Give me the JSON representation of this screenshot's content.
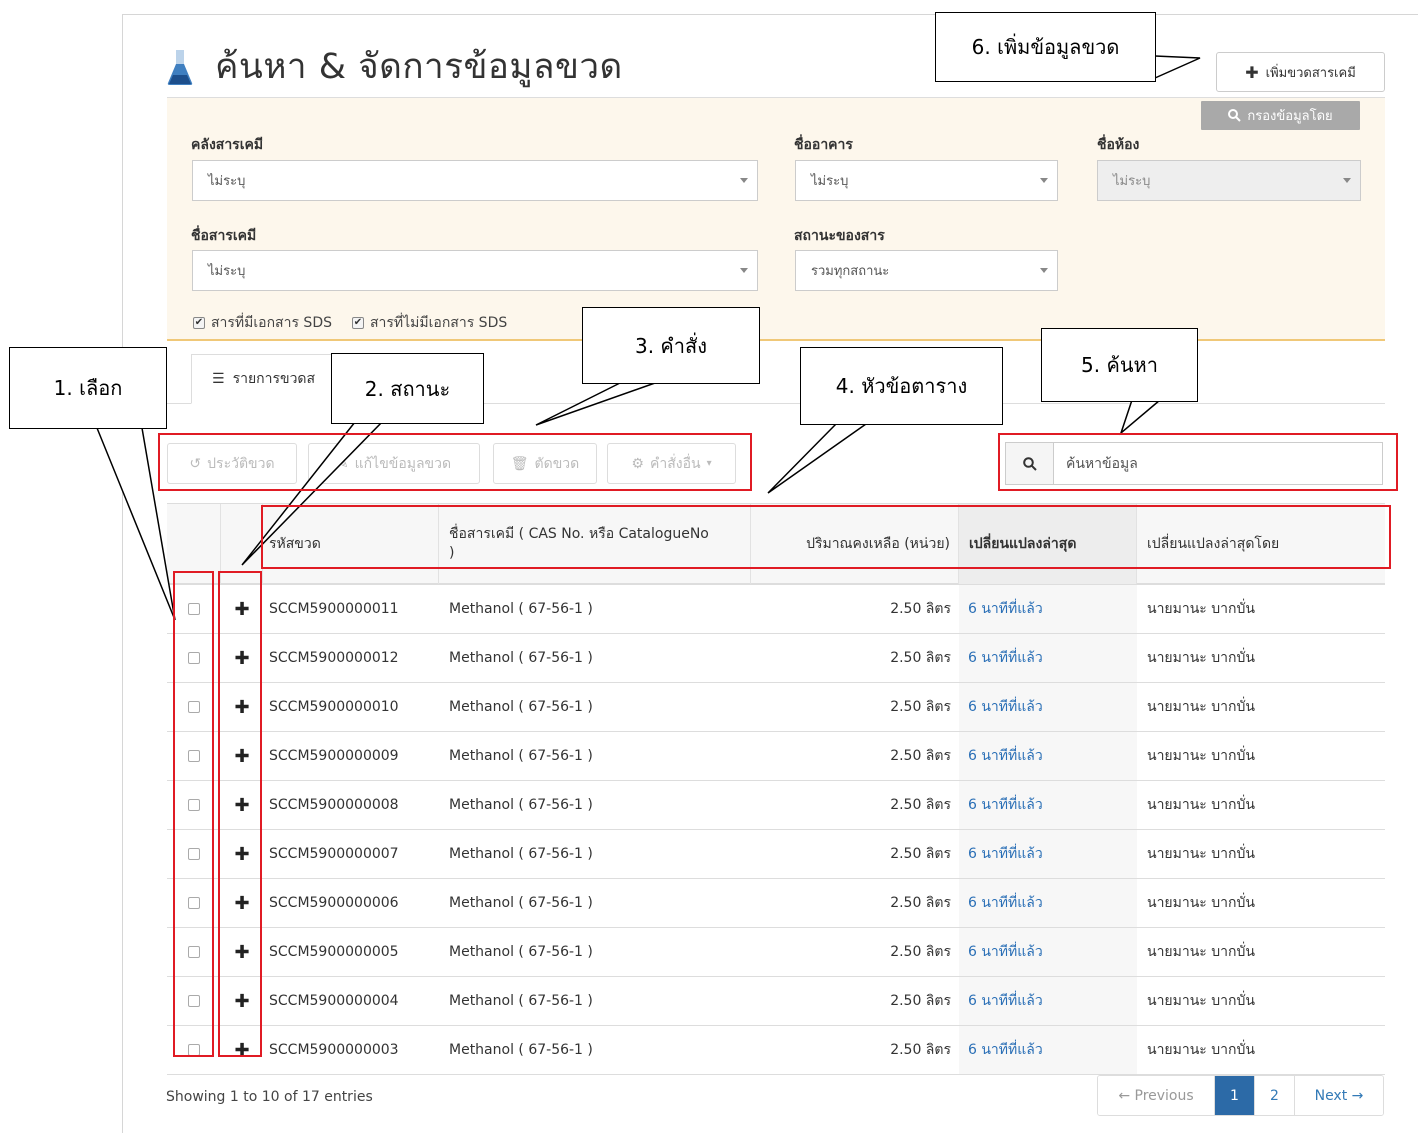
{
  "header": {
    "title": "ค้นหา & จัดการข้อมูลขวด",
    "add_button_label": "เพิ่มขวดสารเคมี"
  },
  "filter": {
    "filter_by_label": "กรองข้อมูลโดย",
    "warehouse_label": "คลังสารเคมี",
    "warehouse_value": "ไม่ระบุ",
    "building_label": "ชื่ออาคาร",
    "building_value": "ไม่ระบุ",
    "room_label": "ชื่อห้อง",
    "room_value": "ไม่ระบุ",
    "chemical_label": "ชื่อสารเคมี",
    "chemical_value": "ไม่ระบุ",
    "state_label": "สถานะของสาร",
    "state_value": "รวมทุกสถานะ",
    "sds_with_label": "สารที่มีเอกสาร SDS",
    "sds_without_label": "สารที่ไม่มีเอกสาร SDS"
  },
  "tab": {
    "label": "รายการขวดส"
  },
  "toolbar": {
    "history_label": "ประวัติขวด",
    "edit_label": "แก้ไขข้อมูลขวด",
    "cut_label": "ตัดขวด",
    "more_label": "คำสั่งอื่น",
    "search_placeholder": "ค้นหาข้อมูล"
  },
  "table": {
    "headers": {
      "code": "รหัสขวด",
      "name": "ชื่อสารเคมี ( CAS No. หรือ CatalogueNo )",
      "qty": "ปริมาณคงเหลือ (หน่วย)",
      "updated": "เปลี่ยนแปลงล่าสุด",
      "updated_by": "เปลี่ยนแปลงล่าสุดโดย"
    },
    "rows": [
      {
        "code": "SCCM5900000011",
        "name": "Methanol ( 67-56-1 )",
        "qty": "2.50 ลิตร",
        "updated": "6 นาทีที่แล้ว",
        "by": "นายมานะ บากบั่น"
      },
      {
        "code": "SCCM5900000012",
        "name": "Methanol ( 67-56-1 )",
        "qty": "2.50 ลิตร",
        "updated": "6 นาทีที่แล้ว",
        "by": "นายมานะ บากบั่น"
      },
      {
        "code": "SCCM5900000010",
        "name": "Methanol ( 67-56-1 )",
        "qty": "2.50 ลิตร",
        "updated": "6 นาทีที่แล้ว",
        "by": "นายมานะ บากบั่น"
      },
      {
        "code": "SCCM5900000009",
        "name": "Methanol ( 67-56-1 )",
        "qty": "2.50 ลิตร",
        "updated": "6 นาทีที่แล้ว",
        "by": "นายมานะ บากบั่น"
      },
      {
        "code": "SCCM5900000008",
        "name": "Methanol ( 67-56-1 )",
        "qty": "2.50 ลิตร",
        "updated": "6 นาทีที่แล้ว",
        "by": "นายมานะ บากบั่น"
      },
      {
        "code": "SCCM5900000007",
        "name": "Methanol ( 67-56-1 )",
        "qty": "2.50 ลิตร",
        "updated": "6 นาทีที่แล้ว",
        "by": "นายมานะ บากบั่น"
      },
      {
        "code": "SCCM5900000006",
        "name": "Methanol ( 67-56-1 )",
        "qty": "2.50 ลิตร",
        "updated": "6 นาทีที่แล้ว",
        "by": "นายมานะ บากบั่น"
      },
      {
        "code": "SCCM5900000005",
        "name": "Methanol ( 67-56-1 )",
        "qty": "2.50 ลิตร",
        "updated": "6 นาทีที่แล้ว",
        "by": "นายมานะ บากบั่น"
      },
      {
        "code": "SCCM5900000004",
        "name": "Methanol ( 67-56-1 )",
        "qty": "2.50 ลิตร",
        "updated": "6 นาทีที่แล้ว",
        "by": "นายมานะ บากบั่น"
      },
      {
        "code": "SCCM5900000003",
        "name": "Methanol ( 67-56-1 )",
        "qty": "2.50 ลิตร",
        "updated": "6 นาทีที่แล้ว",
        "by": "นายมานะ บากบั่น"
      }
    ]
  },
  "footer": {
    "info": "Showing 1 to 10 of 17 entries",
    "prev": "← Previous",
    "page1": "1",
    "page2": "2",
    "next": "Next →"
  },
  "annotations": {
    "select": "1. เลือก",
    "status": "2. สถานะ",
    "command": "3. คำสั่ง",
    "table_header": "4. หัวข้อตาราง",
    "search": "5. ค้นหา",
    "add_data": "6. เพิ่มข้อมูลขวด"
  },
  "colors": {
    "annotation_red": "#e01b24",
    "filter_bg": "#fdf7ec",
    "link": "#2a6fb6",
    "pager_active": "#2c6aa7"
  }
}
